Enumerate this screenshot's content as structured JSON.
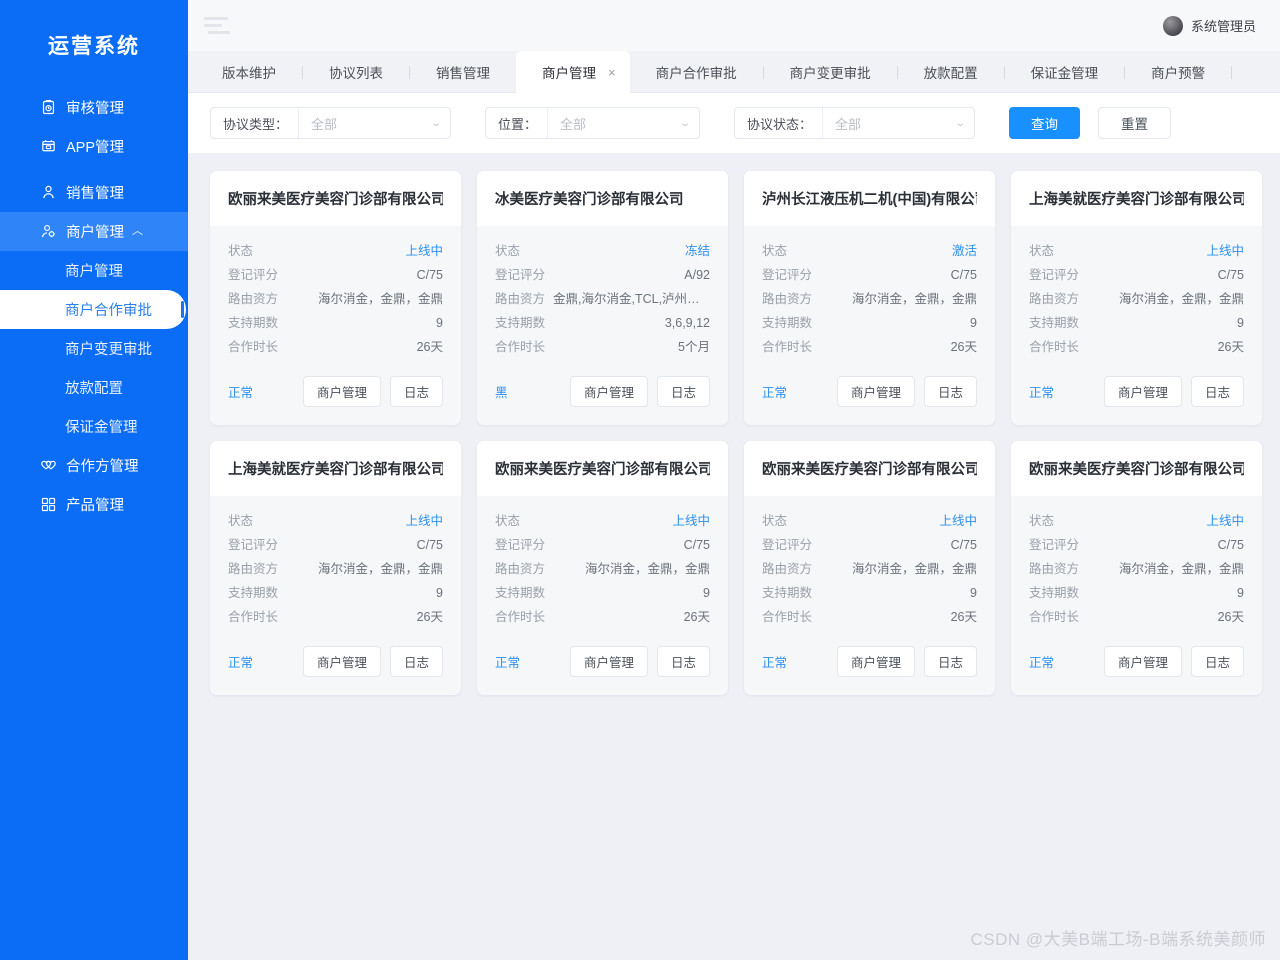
{
  "sidebar": {
    "brand": "运营系统",
    "items": [
      {
        "label": "审核管理",
        "icon": "clipboard-check-icon",
        "type": "link"
      },
      {
        "label": "APP管理",
        "icon": "app-grid-icon",
        "type": "link"
      },
      {
        "label": "销售管理",
        "icon": "user-sales-icon",
        "type": "link"
      },
      {
        "label": "商户管理",
        "icon": "user-gear-icon",
        "type": "group",
        "expanded": true,
        "caret": "︿"
      },
      {
        "label": "合作方管理",
        "icon": "handshake-heart-icon",
        "type": "link"
      },
      {
        "label": "产品管理",
        "icon": "squares-icon",
        "type": "link"
      }
    ],
    "submenu": [
      {
        "label": "商户管理",
        "active": false
      },
      {
        "label": "商户合作审批",
        "active": true
      },
      {
        "label": "商户变更审批",
        "active": false
      },
      {
        "label": "放款配置",
        "active": false
      },
      {
        "label": "保证金管理",
        "active": false
      }
    ]
  },
  "topbar": {
    "menu_toggle": "hamburger-icon",
    "user": "系统管理员",
    "avatar": "user-avatar"
  },
  "tabs": [
    {
      "label": "版本维护",
      "active": false,
      "closable": false
    },
    {
      "label": "协议列表",
      "active": false,
      "closable": false
    },
    {
      "label": "销售管理",
      "active": false,
      "closable": false
    },
    {
      "label": "商户管理",
      "active": true,
      "closable": true,
      "close": "×"
    },
    {
      "label": "商户合作审批",
      "active": false,
      "closable": false
    },
    {
      "label": "商户变更审批",
      "active": false,
      "closable": false
    },
    {
      "label": "放款配置",
      "active": false,
      "closable": false
    },
    {
      "label": "保证金管理",
      "active": false,
      "closable": false
    },
    {
      "label": "商户预警",
      "active": false,
      "closable": false
    }
  ],
  "filters": [
    {
      "label": "协议类型：",
      "value": "全部",
      "name": "agreement-type"
    },
    {
      "label": "位置：",
      "value": "全部",
      "name": "position"
    },
    {
      "label": "协议状态：",
      "value": "全部",
      "name": "agreement-status"
    }
  ],
  "filter_actions": {
    "search": "查询",
    "reset": "重置"
  },
  "field_labels": {
    "status": "状态",
    "score": "登记评分",
    "funder": "路由资方",
    "terms": "支持期数",
    "duration": "合作时长"
  },
  "card_actions": {
    "manage": "商户管理",
    "log": "日志"
  },
  "cards": [
    {
      "title": "欧丽来美医疗美容门诊部有限公司",
      "status": "上线中",
      "score": "C/75",
      "funder": "海尔消金，金鼎，金鼎",
      "terms": "9",
      "duration": "26天",
      "flag": "正常"
    },
    {
      "title": "冰美医疗美容门诊部有限公司",
      "status": "冻结",
      "score": "A/92",
      "funder": "金鼎,海尔消金,TCL,泸州银行",
      "terms": "3,6,9,12",
      "duration": "5个月",
      "flag": "黑"
    },
    {
      "title": "泸州长江液压机二机(中国)有限公司",
      "status": "激活",
      "score": "C/75",
      "funder": "海尔消金，金鼎，金鼎",
      "terms": "9",
      "duration": "26天",
      "flag": "正常"
    },
    {
      "title": "上海美就医疗美容门诊部有限公司",
      "status": "上线中",
      "score": "C/75",
      "funder": "海尔消金，金鼎，金鼎",
      "terms": "9",
      "duration": "26天",
      "flag": "正常"
    },
    {
      "title": "上海美就医疗美容门诊部有限公司",
      "status": "上线中",
      "score": "C/75",
      "funder": "海尔消金，金鼎，金鼎",
      "terms": "9",
      "duration": "26天",
      "flag": "正常"
    },
    {
      "title": "欧丽来美医疗美容门诊部有限公司",
      "status": "上线中",
      "score": "C/75",
      "funder": "海尔消金，金鼎，金鼎",
      "terms": "9",
      "duration": "26天",
      "flag": "正常"
    },
    {
      "title": "欧丽来美医疗美容门诊部有限公司",
      "status": "上线中",
      "score": "C/75",
      "funder": "海尔消金，金鼎，金鼎",
      "terms": "9",
      "duration": "26天",
      "flag": "正常"
    },
    {
      "title": "欧丽来美医疗美容门诊部有限公司",
      "status": "上线中",
      "score": "C/75",
      "funder": "海尔消金，金鼎，金鼎",
      "terms": "9",
      "duration": "26天",
      "flag": "正常"
    }
  ],
  "watermark": "CSDN @大美B端工场-B端系统美颜师",
  "colors": {
    "sidebar": "#0b6cf5",
    "primary": "#1890ff",
    "link": "#2b90f0",
    "page_bg": "#eef0f5"
  }
}
